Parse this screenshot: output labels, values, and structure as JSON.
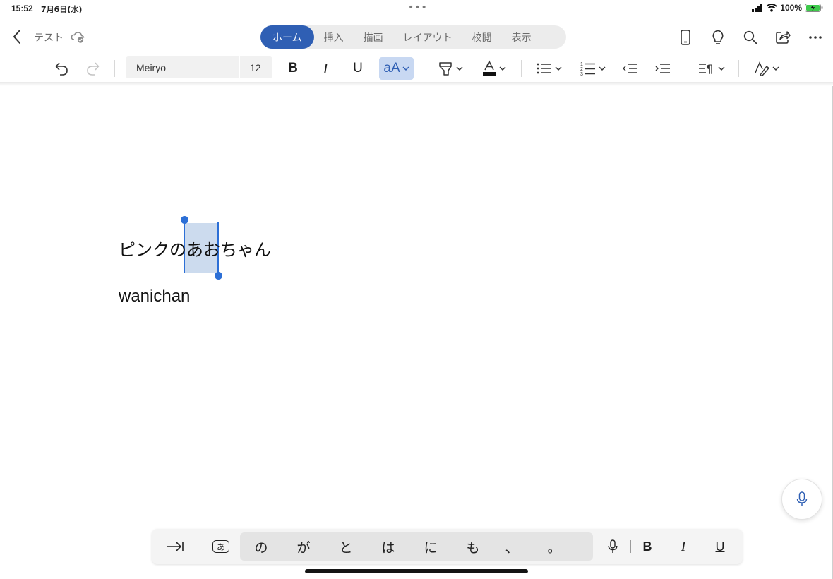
{
  "status_bar": {
    "time": "15:52",
    "date": "7月6日(水)",
    "battery_percent": "100%"
  },
  "title_bar": {
    "doc_title": "テスト",
    "tabs": [
      {
        "label": "ホーム",
        "active": true
      },
      {
        "label": "挿入",
        "active": false
      },
      {
        "label": "描画",
        "active": false
      },
      {
        "label": "レイアウト",
        "active": false
      },
      {
        "label": "校閲",
        "active": false
      },
      {
        "label": "表示",
        "active": false
      }
    ]
  },
  "ribbon": {
    "font_name": "Meiryo",
    "font_size": "12",
    "bold_label": "B",
    "italic_label": "I",
    "underline_label": "U",
    "text_effects_label": "aA"
  },
  "document": {
    "line1_before": "ピンクの",
    "line1_selected": "あお",
    "line1_after": "ちゃん",
    "line2": "wanichan"
  },
  "keyboard_bar": {
    "kana_icon_label": "あ",
    "candidates": [
      "の",
      "が",
      "と",
      "は",
      "に",
      "も",
      "、",
      "。"
    ],
    "bold_label": "B",
    "italic_label": "I",
    "underline_label": "U"
  },
  "colors": {
    "accent": "#2f5fb4",
    "selection": "#c8d8f2",
    "handle": "#2c6fd6"
  }
}
